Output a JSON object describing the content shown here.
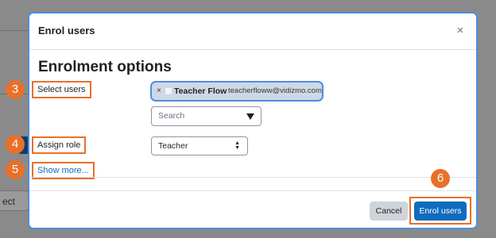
{
  "background": {
    "select_text": "ect"
  },
  "modal": {
    "title": "Enrol users",
    "close_icon": "×",
    "heading": "Enrolment options",
    "select_users_label": "Select users",
    "selected_user": {
      "remove_icon": "×",
      "name": "Teacher Flow",
      "email": "teacherfloww@vidizmo.com"
    },
    "search_placeholder": "Search",
    "assign_role_label": "Assign role",
    "role_value": "Teacher",
    "role_icon": "⬍",
    "show_more": "Show more...",
    "cancel_label": "Cancel",
    "enrol_label": "Enrol users"
  },
  "callouts": {
    "step3": "3",
    "step4": "4",
    "step5": "5",
    "step6": "6"
  },
  "colors": {
    "accent": "#0f6cbf",
    "callout": "#e8702a",
    "focus_border": "#4a90e2"
  }
}
